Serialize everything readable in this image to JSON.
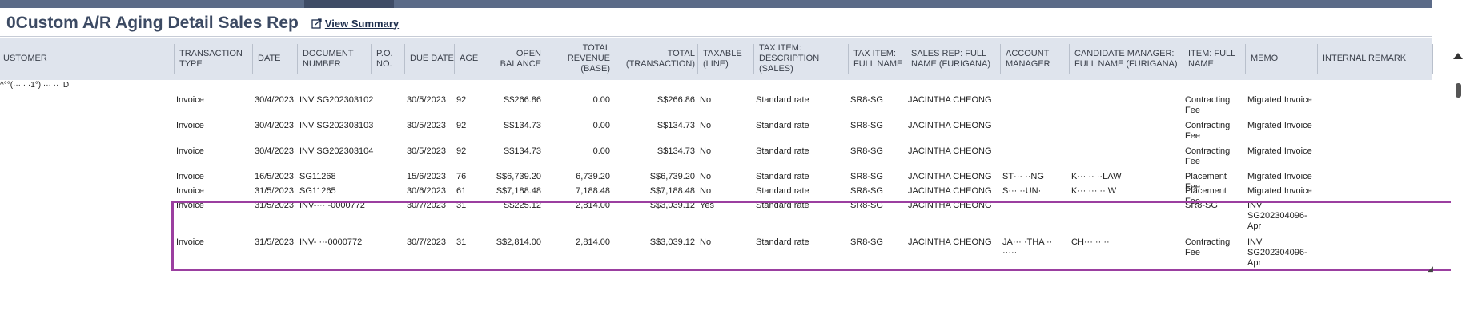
{
  "page": {
    "title": "0Custom A/R Aging Detail Sales Rep",
    "view_summary": "View Summary"
  },
  "columns": [
    {
      "key": "customer",
      "label": "USTOMER"
    },
    {
      "key": "type",
      "label": "TRANSACTION TYPE"
    },
    {
      "key": "date",
      "label": "DATE"
    },
    {
      "key": "doc",
      "label": "DOCUMENT NUMBER"
    },
    {
      "key": "po",
      "label": "P.O. NO."
    },
    {
      "key": "due",
      "label": "DUE DATE"
    },
    {
      "key": "age",
      "label": "AGE"
    },
    {
      "key": "open",
      "label": "OPEN BALANCE"
    },
    {
      "key": "revenue",
      "label": "TOTAL REVENUE (BASE)"
    },
    {
      "key": "total",
      "label": "TOTAL (TRANSACTION)"
    },
    {
      "key": "taxable",
      "label": "TAXABLE (LINE)"
    },
    {
      "key": "taxdesc",
      "label": "TAX ITEM: DESCRIPTION (SALES)"
    },
    {
      "key": "taxname",
      "label": "TAX ITEM: FULL NAME"
    },
    {
      "key": "salesrep",
      "label": "SALES REP: FULL NAME (FURIGANA)"
    },
    {
      "key": "acctmgr",
      "label": "ACCOUNT MANAGER"
    },
    {
      "key": "candmgr",
      "label": "CANDIDATE MANAGER: FULL NAME (FURIGANA)"
    },
    {
      "key": "item",
      "label": "ITEM: FULL NAME"
    },
    {
      "key": "memo",
      "label": "MEMO"
    },
    {
      "key": "remark",
      "label": "INTERNAL REMARK"
    }
  ],
  "customer_group": "^°°(··· · ·1°) ··· ·· ,D.",
  "rows": [
    {
      "type": "Invoice",
      "date": "30/4/2023",
      "doc": "INV SG202303102",
      "po": "",
      "due": "30/5/2023",
      "age": "92",
      "open": "S$266.86",
      "revenue": "0.00",
      "total": "S$266.86",
      "taxable": "No",
      "taxdesc": "Standard rate",
      "taxname": "SR8-SG",
      "salesrep": "JACINTHA CHEONG",
      "acctmgr": "",
      "candmgr": "",
      "item": "Contracting Fee",
      "memo": "Migrated Invoice",
      "remark": ""
    },
    {
      "type": "Invoice",
      "date": "30/4/2023",
      "doc": "INV SG202303103",
      "po": "",
      "due": "30/5/2023",
      "age": "92",
      "open": "S$134.73",
      "revenue": "0.00",
      "total": "S$134.73",
      "taxable": "No",
      "taxdesc": "Standard rate",
      "taxname": "SR8-SG",
      "salesrep": "JACINTHA CHEONG",
      "acctmgr": "",
      "candmgr": "",
      "item": "Contracting Fee",
      "memo": "Migrated Invoice",
      "remark": ""
    },
    {
      "type": "Invoice",
      "date": "30/4/2023",
      "doc": "INV SG202303104",
      "po": "",
      "due": "30/5/2023",
      "age": "92",
      "open": "S$134.73",
      "revenue": "0.00",
      "total": "S$134.73",
      "taxable": "No",
      "taxdesc": "Standard rate",
      "taxname": "SR8-SG",
      "salesrep": "JACINTHA CHEONG",
      "acctmgr": "",
      "candmgr": "",
      "item": "Contracting Fee",
      "memo": "Migrated Invoice",
      "remark": ""
    },
    {
      "type": "Invoice",
      "date": "16/5/2023",
      "doc": "SG11268",
      "po": "",
      "due": "15/6/2023",
      "age": "76",
      "open": "S$6,739.20",
      "revenue": "6,739.20",
      "total": "S$6,739.20",
      "taxable": "No",
      "taxdesc": "Standard rate",
      "taxname": "SR8-SG",
      "salesrep": "JACINTHA CHEONG",
      "acctmgr": "ST··· ··NG",
      "candmgr": "K··· ·· ··LAW",
      "item": "Placement Fee",
      "memo": "Migrated Invoice",
      "remark": ""
    },
    {
      "type": "Invoice",
      "date": "31/5/2023",
      "doc": "SG11265",
      "po": "",
      "due": "30/6/2023",
      "age": "61",
      "open": "S$7,188.48",
      "revenue": "7,188.48",
      "total": "S$7,188.48",
      "taxable": "No",
      "taxdesc": "Standard rate",
      "taxname": "SR8-SG",
      "salesrep": "JACINTHA CHEONG",
      "acctmgr": "S··· ··UN·",
      "candmgr": "K··· ··· ·· W",
      "item": "Placement Fee",
      "memo": "Migrated Invoice",
      "remark": ""
    },
    {
      "type": "Invoice",
      "date": "31/5/2023",
      "doc": "INV-··· -0000772",
      "po": "",
      "due": "30/7/2023",
      "age": "31",
      "open": "S$225.12",
      "revenue": "2,814.00",
      "total": "S$3,039.12",
      "taxable": "Yes",
      "taxdesc": "Standard rate",
      "taxname": "SR8-SG",
      "salesrep": "JACINTHA CHEONG",
      "acctmgr": "",
      "candmgr": "",
      "item": "SR8-SG",
      "memo": "INV SG202304096-Apr",
      "remark": ""
    },
    {
      "type": "Invoice",
      "date": "31/5/2023",
      "doc": "INV- ··-0000772",
      "po": "",
      "due": "30/7/2023",
      "age": "31",
      "open": "S$2,814.00",
      "revenue": "2,814.00",
      "total": "S$3,039.12",
      "taxable": "No",
      "taxdesc": "Standard rate",
      "taxname": "SR8-SG",
      "salesrep": "JACINTHA CHEONG",
      "acctmgr": "JA··· ·THA ·· ·····",
      "candmgr": "CH··· ·· ··",
      "item": "Contracting Fee",
      "memo": "INV SG202304096-Apr",
      "remark": ""
    }
  ],
  "colors": {
    "highlight": "#9b3fa0",
    "header_bg": "#dfe4ed",
    "title": "#3c4a63"
  }
}
